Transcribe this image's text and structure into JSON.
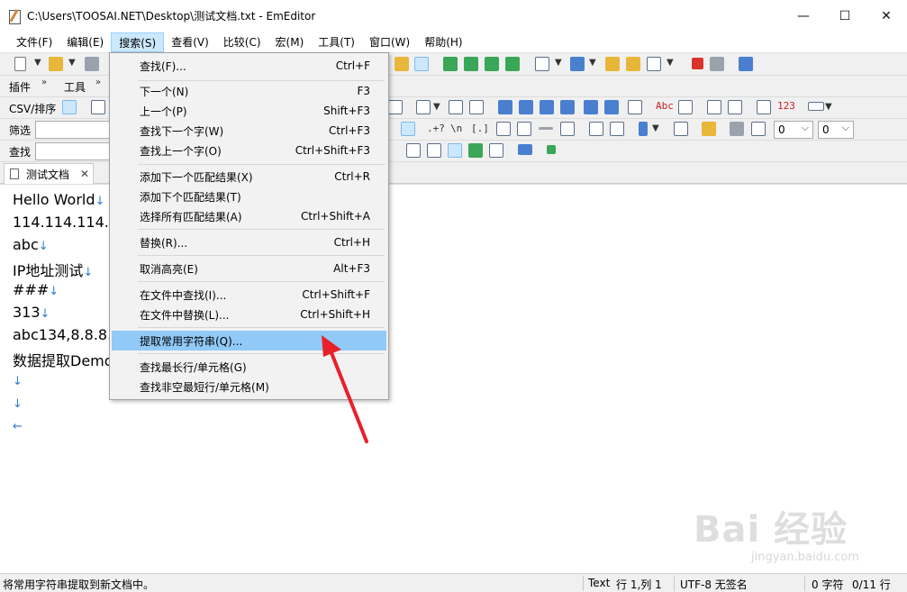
{
  "window": {
    "title": "C:\\Users\\TOOSAI.NET\\Desktop\\测试文档.txt - EmEditor",
    "minimize": "—",
    "maximize": "☐",
    "close": "✕"
  },
  "menubar": {
    "items": [
      {
        "label": "文件(F)"
      },
      {
        "label": "编辑(E)"
      },
      {
        "label": "搜索(S)"
      },
      {
        "label": "查看(V)"
      },
      {
        "label": "比较(C)"
      },
      {
        "label": "宏(M)"
      },
      {
        "label": "工具(T)"
      },
      {
        "label": "窗口(W)"
      },
      {
        "label": "帮助(H)"
      }
    ],
    "active_index": 2
  },
  "toolbars": {
    "plugins_label": "插件",
    "tools_label": "工具",
    "csv_label": "CSV/排序",
    "filter_label": "筛选",
    "find_label": "查找",
    "chevron": "»",
    "zero_a": "0",
    "zero_b": "0",
    "icons_text": {
      "regex": ".+?",
      "newline": "\\n",
      "brackets": "[.]",
      "abc": "Abc",
      "num": "123"
    }
  },
  "tab": {
    "label": "测试文档",
    "close": "✕"
  },
  "editor": {
    "lines": [
      "Hello World",
      "114.114.114.11",
      "abc",
      "IP地址测试",
      "###",
      "313",
      "abc134,8.8.8.8",
      "数据提取Demo",
      "",
      "",
      ""
    ],
    "eol_down": "↓",
    "eof_mark": "←"
  },
  "search_menu": {
    "items": [
      {
        "label": "查找(F)...",
        "shortcut": "Ctrl+F"
      },
      {
        "label": "下一个(N)",
        "shortcut": "F3"
      },
      {
        "label": "上一个(P)",
        "shortcut": "Shift+F3"
      },
      {
        "label": "查找下一个字(W)",
        "shortcut": "Ctrl+F3"
      },
      {
        "label": "查找上一个字(O)",
        "shortcut": "Ctrl+Shift+F3"
      },
      {
        "label": "添加下一个匹配结果(X)",
        "shortcut": "Ctrl+R"
      },
      {
        "label": "添加下个匹配结果(T)",
        "shortcut": ""
      },
      {
        "label": "选择所有匹配结果(A)",
        "shortcut": "Ctrl+Shift+A"
      },
      {
        "label": "替换(R)...",
        "shortcut": "Ctrl+H"
      },
      {
        "label": "取消高亮(E)",
        "shortcut": "Alt+F3"
      },
      {
        "label": "在文件中查找(I)...",
        "shortcut": "Ctrl+Shift+F"
      },
      {
        "label": "在文件中替换(L)...",
        "shortcut": "Ctrl+Shift+H"
      },
      {
        "label": "提取常用字符串(Q)...",
        "shortcut": ""
      },
      {
        "label": "查找最长行/单元格(G)",
        "shortcut": ""
      },
      {
        "label": "查找非空最短行/单元格(M)",
        "shortcut": ""
      }
    ],
    "highlighted_index": 12
  },
  "statusbar": {
    "message": "将常用字符串提取到新文档中。",
    "type": "Text",
    "position": "行 1,列 1",
    "encoding": "UTF-8 无签名",
    "chars": "0 字符",
    "lines": "0/11 行"
  },
  "watermark": {
    "text": "Bai 经验",
    "url": "jingyan.baidu.com"
  },
  "colors": {
    "menu_highlight": "#91c9f7",
    "active_menu": "#cce8ff",
    "eol_blue": "#2d7dd2",
    "arrow_red": "#e8202a"
  }
}
